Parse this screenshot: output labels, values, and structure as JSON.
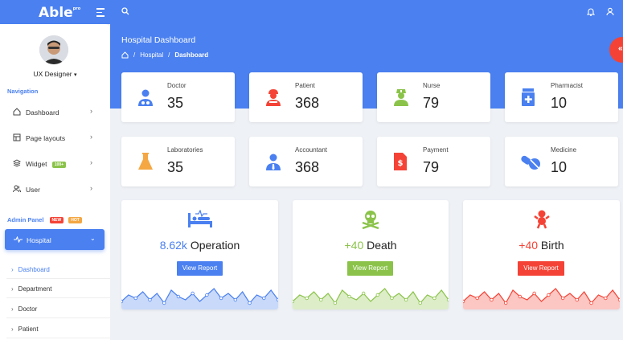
{
  "app": {
    "logo": "Able",
    "logo_sup": "pro"
  },
  "colors": {
    "primary": "#4a80f0",
    "red": "#f44336",
    "green": "#8bc34a",
    "orange": "#f4a742",
    "new_badge": "#f44336",
    "hot_badge": "#f4a742",
    "widget_badge": "#8bc34a"
  },
  "header": {
    "title": "Hospital Dashboard",
    "breadcrumb": [
      "Hospital",
      "Dashboard"
    ]
  },
  "sidebar": {
    "user_name": "UX Designer",
    "nav_caption": "Navigation",
    "items": [
      {
        "label": "Dashboard",
        "icon": "home-icon"
      },
      {
        "label": "Page layouts",
        "icon": "layout-icon"
      },
      {
        "label": "Widget",
        "icon": "layers-icon",
        "badge": "100+"
      },
      {
        "label": "User",
        "icon": "users-icon"
      }
    ],
    "admin_caption": "Admin Panel",
    "admin_badges": [
      "NEW",
      "HOT"
    ],
    "active_item": "Hospital",
    "subitems": [
      "Dashboard",
      "Department",
      "Doctor",
      "Patient"
    ]
  },
  "stats": [
    {
      "label": "Doctor",
      "value": "35",
      "icon": "doctor-icon"
    },
    {
      "label": "Patient",
      "value": "368",
      "icon": "patient-icon"
    },
    {
      "label": "Nurse",
      "value": "79",
      "icon": "nurse-icon"
    },
    {
      "label": "Pharmacist",
      "value": "10",
      "icon": "pharmacist-icon"
    },
    {
      "label": "Laboratories",
      "value": "35",
      "icon": "flask-icon"
    },
    {
      "label": "Accountant",
      "value": "368",
      "icon": "accountant-icon"
    },
    {
      "label": "Payment",
      "value": "79",
      "icon": "invoice-icon"
    },
    {
      "label": "Medicine",
      "value": "10",
      "icon": "pills-icon"
    }
  ],
  "reports": [
    {
      "value": "8.62k",
      "label": "Operation",
      "button": "View Report",
      "icon": "bed-icon"
    },
    {
      "value": "+40",
      "label": "Death",
      "button": "View Report",
      "icon": "skull-icon"
    },
    {
      "value": "+40",
      "label": "Birth",
      "button": "View Report",
      "icon": "baby-icon"
    }
  ]
}
